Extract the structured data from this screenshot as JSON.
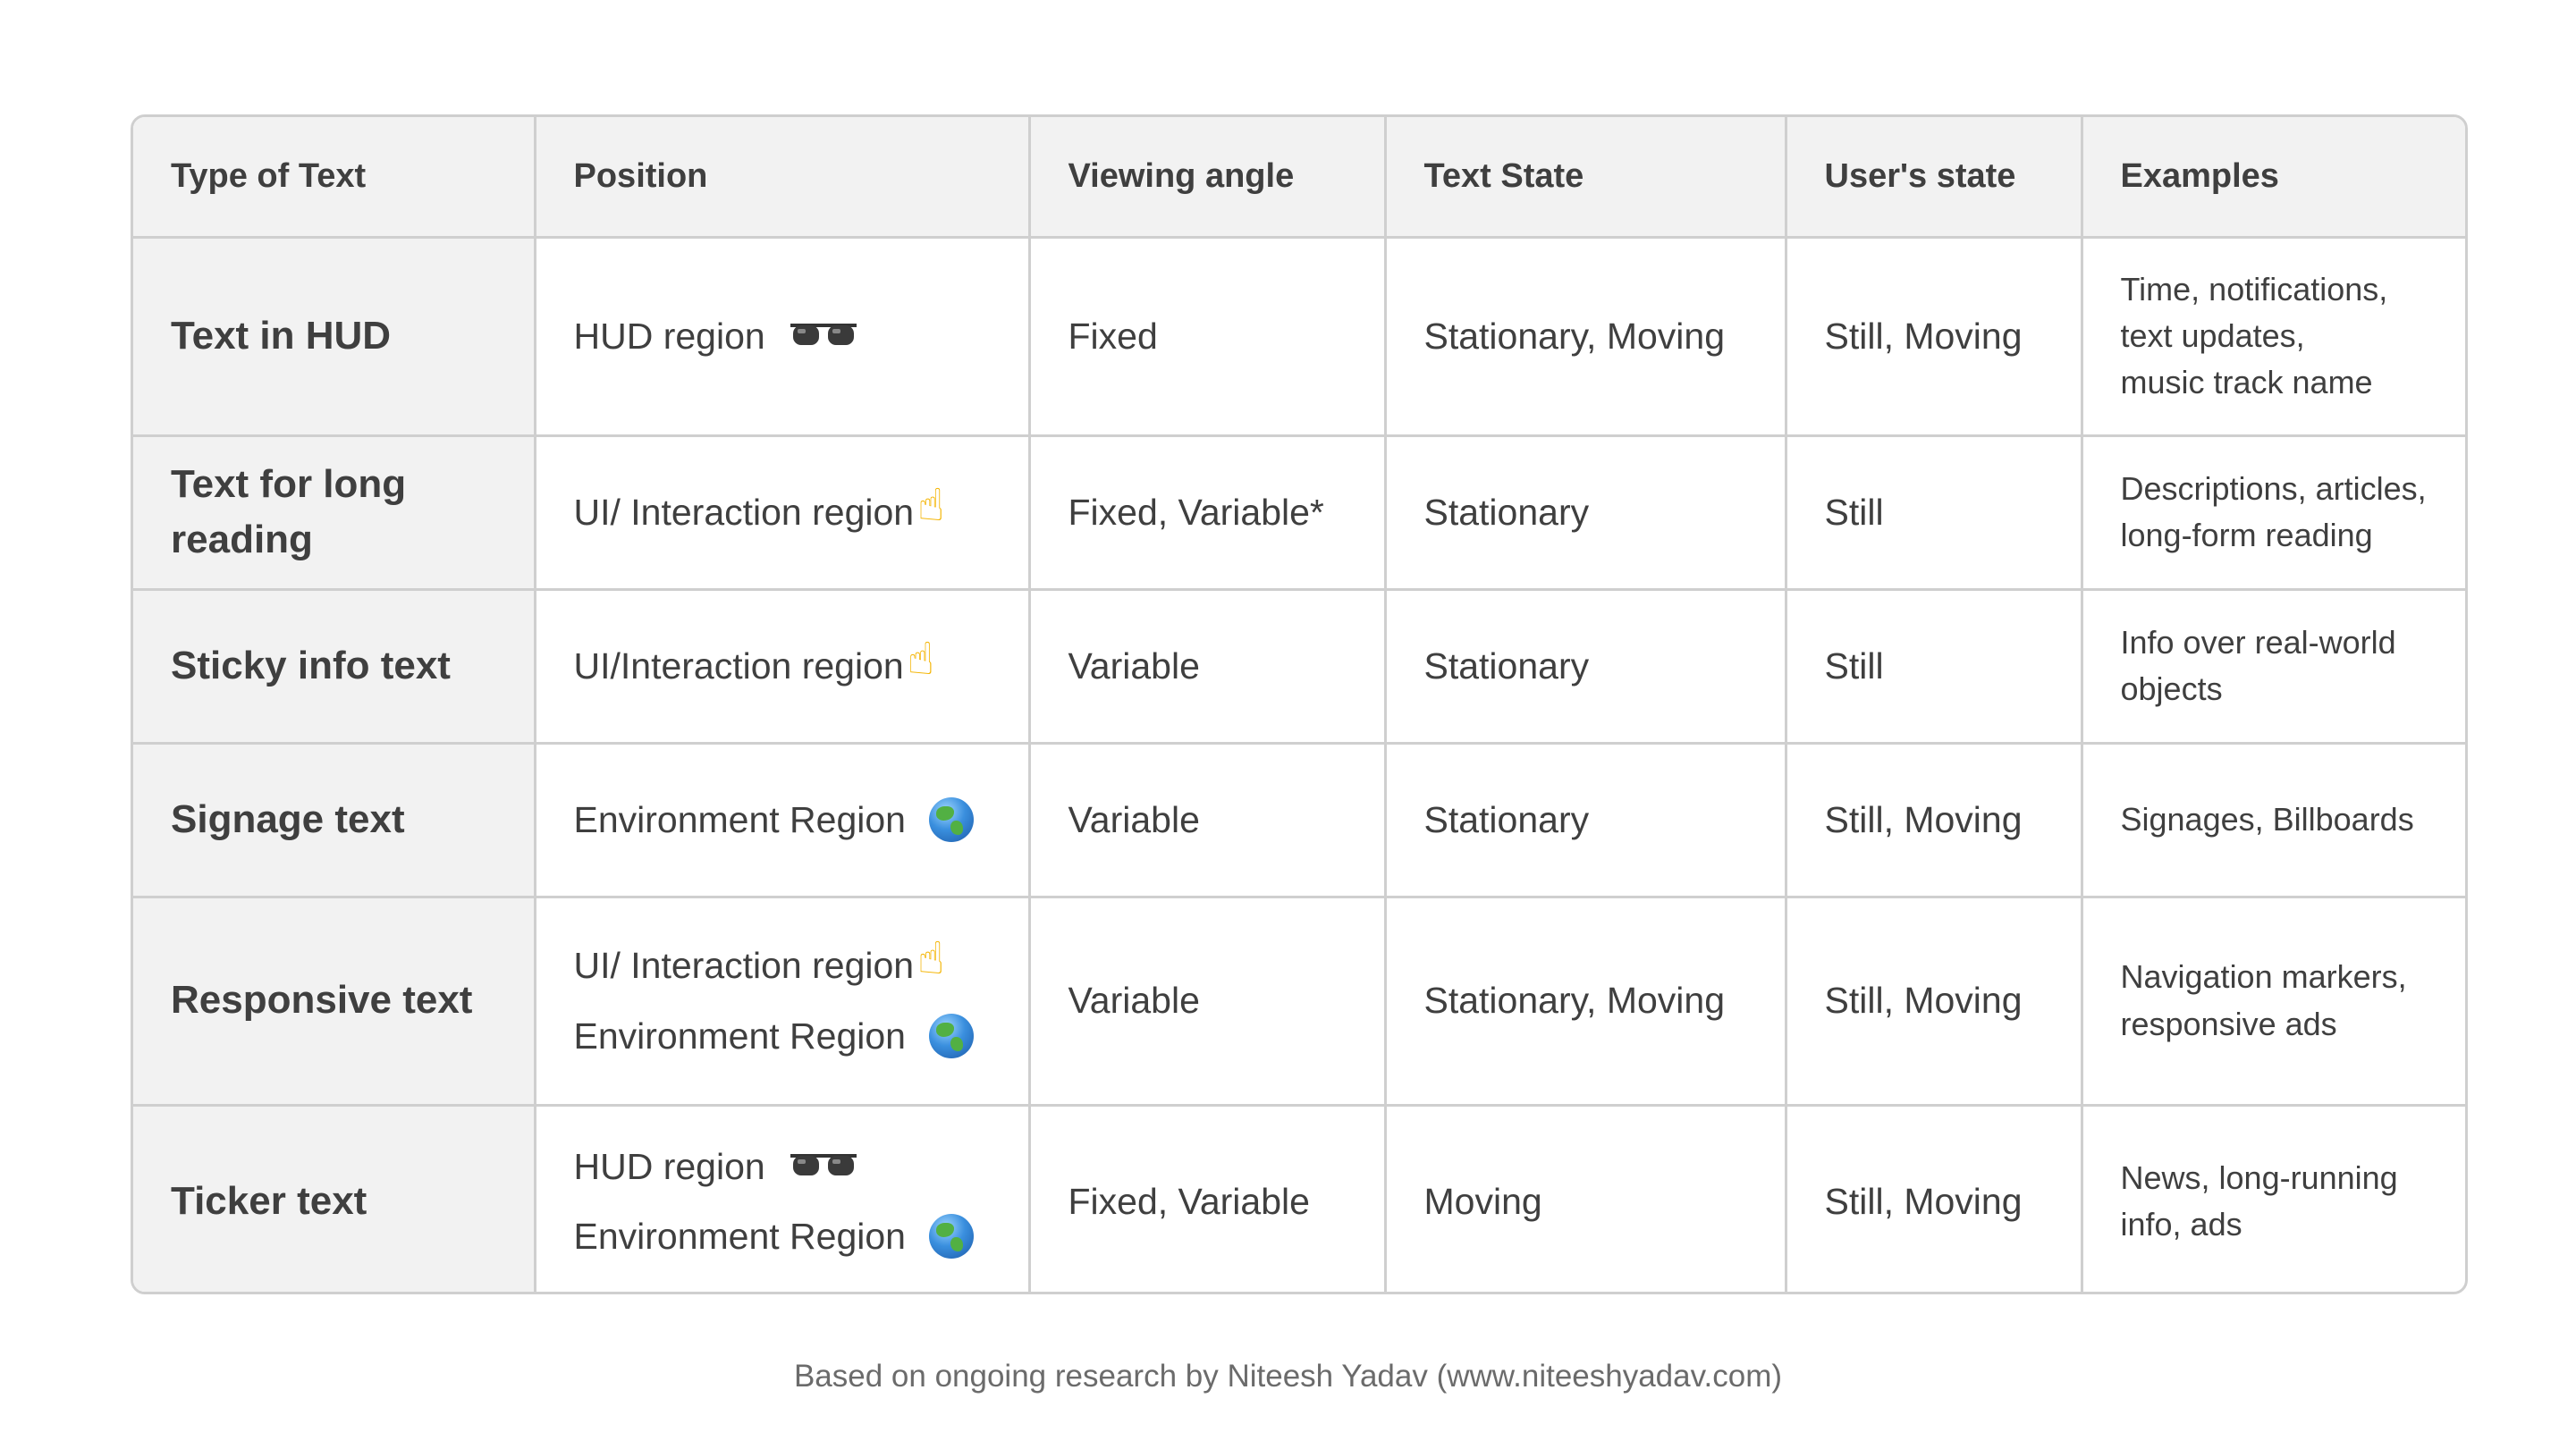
{
  "columns": [
    "Type of Text",
    "Position",
    "Viewing angle",
    "Text State",
    "User's state",
    "Examples"
  ],
  "rows": [
    {
      "type": "Text in HUD",
      "position": [
        {
          "text": "HUD region",
          "icon": "glasses-icon"
        }
      ],
      "viewing_angle": "Fixed",
      "text_state": "Stationary, Moving",
      "user_state": "Still, Moving",
      "examples": [
        "Time, notifications,",
        "text updates,",
        "music track name"
      ]
    },
    {
      "type": "Text for long reading",
      "position": [
        {
          "text": "UI/ Interaction region",
          "icon": "pointing-hand-icon"
        }
      ],
      "viewing_angle": "Fixed, Variable*",
      "text_state": "Stationary",
      "user_state": "Still",
      "examples": [
        "Descriptions, articles,",
        "long-form reading"
      ]
    },
    {
      "type": "Sticky info text",
      "position": [
        {
          "text": "UI/Interaction region",
          "icon": "pointing-hand-icon"
        }
      ],
      "viewing_angle": "Variable",
      "text_state": "Stationary",
      "user_state": "Still",
      "examples": [
        "Info over real-world",
        "objects"
      ]
    },
    {
      "type": "Signage text",
      "position": [
        {
          "text": "Environment Region",
          "icon": "globe-icon"
        }
      ],
      "viewing_angle": "Variable",
      "text_state": "Stationary",
      "user_state": "Still, Moving",
      "examples": [
        "Signages, Billboards"
      ]
    },
    {
      "type": "Responsive text",
      "position": [
        {
          "text": "UI/ Interaction region",
          "icon": "pointing-hand-icon"
        },
        {
          "text": "Environment Region",
          "icon": "globe-icon"
        }
      ],
      "viewing_angle": "Variable",
      "text_state": "Stationary, Moving",
      "user_state": "Still, Moving",
      "examples": [
        "Navigation markers,",
        "responsive ads"
      ]
    },
    {
      "type": "Ticker text",
      "position": [
        {
          "text": "HUD region",
          "icon": "glasses-icon"
        },
        {
          "text": "Environment Region",
          "icon": "globe-icon"
        }
      ],
      "viewing_angle": "Fixed, Variable",
      "text_state": "Moving",
      "user_state": "Still, Moving",
      "examples": [
        "News, long-running",
        "info, ads"
      ]
    }
  ],
  "footer": "Based on ongoing research by Niteesh Yadav (www.niteeshyadav.com)"
}
